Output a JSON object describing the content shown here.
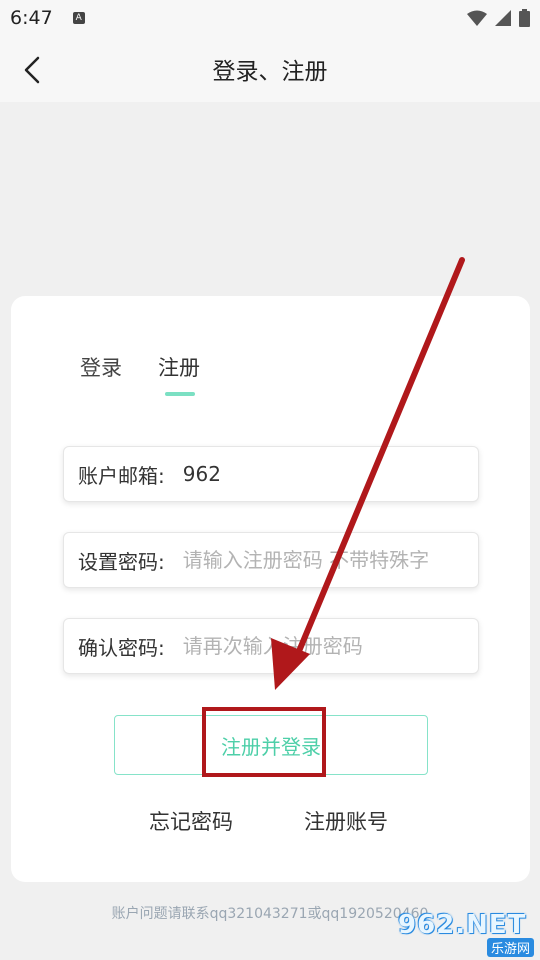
{
  "status_bar": {
    "time": "6:47",
    "notification_icon": "A"
  },
  "app_bar": {
    "title": "登录、注册"
  },
  "tabs": {
    "login": "登录",
    "register": "注册",
    "active": "register"
  },
  "form": {
    "email": {
      "label": "账户邮箱:",
      "value": "962",
      "placeholder": ""
    },
    "password": {
      "label": "设置密码:",
      "value": "",
      "placeholder": "请输入注册密码 不带特殊字"
    },
    "confirm": {
      "label": "确认密码:",
      "value": "",
      "placeholder": "请再次输入注册密码"
    }
  },
  "submit_label": "注册并登录",
  "links": {
    "forgot": "忘记密码",
    "register_account": "注册账号"
  },
  "footer_note": "账户问题请联系qq321043271或qq1920520460",
  "watermark": {
    "main": "962.NET",
    "sub": "乐游网"
  },
  "colors": {
    "accent": "#4dcfa8",
    "annotation": "#b0181b"
  }
}
